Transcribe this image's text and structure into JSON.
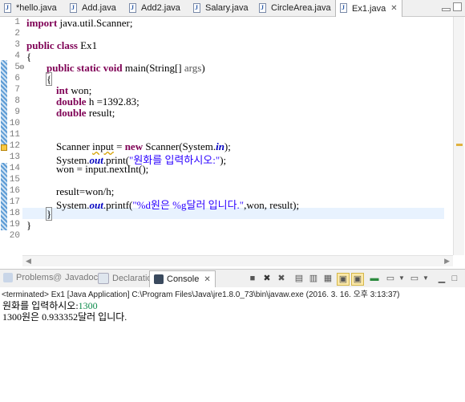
{
  "editor_tabs": [
    {
      "label": "*hello.java"
    },
    {
      "label": "Add.java"
    },
    {
      "label": "Add2.java"
    },
    {
      "label": "Salary.java"
    },
    {
      "label": "CircleArea.java"
    },
    {
      "label": "Ex1.java",
      "active": true
    }
  ],
  "editor": {
    "line_numbers": [
      "1",
      "2",
      "3",
      "4",
      "5",
      "6",
      "7",
      "8",
      "9",
      "10",
      "11",
      "12",
      "13",
      "14",
      "15",
      "16",
      "17",
      "18",
      "19",
      "20"
    ],
    "lines": [
      [
        "import",
        " java.util.Scanner;"
      ],
      [],
      [
        "public class",
        " Ex1"
      ],
      [
        "{"
      ],
      [
        "public static void",
        " main(String[] ",
        "args",
        ")"
      ],
      [
        "{"
      ],
      [
        "int",
        " won;"
      ],
      [
        "double",
        " h =1392.83;"
      ],
      [
        "double",
        " result;"
      ],
      [],
      [],
      [
        "Scanner ",
        "input",
        " = ",
        "new",
        " Scanner(System.",
        "in",
        ");"
      ],
      [
        "System.",
        "out",
        ".print(",
        "\"원화를 입력하시오:\"",
        ");"
      ],
      [
        "won = input.nextInt();"
      ],
      [],
      [
        "result=won/h;"
      ],
      [
        "System.",
        "out",
        ".printf(",
        "\"%d원은 %g달러 입니다.\"",
        ",won, result);"
      ],
      [
        "}"
      ],
      [
        "}"
      ],
      []
    ]
  },
  "view_tabs": [
    {
      "label": "Problems"
    },
    {
      "label": "Javadoc"
    },
    {
      "label": "Declaration"
    },
    {
      "label": "Console",
      "active": true
    }
  ],
  "console": {
    "terminated_line": "<terminated> Ex1 [Java Application] C:\\Program Files\\Java\\jre1.8.0_73\\bin\\javaw.exe (2016. 3. 16. 오후 3:13:37)",
    "prompt": "원화를 입력하시오:",
    "input_value": "1300",
    "result_line": "1300원은 0.933352달러 입니다."
  },
  "colors": {
    "keyword": "#7f0055",
    "string": "#2a00ff",
    "static_field": "#0000c0",
    "console_input": "#0b8a4a"
  }
}
